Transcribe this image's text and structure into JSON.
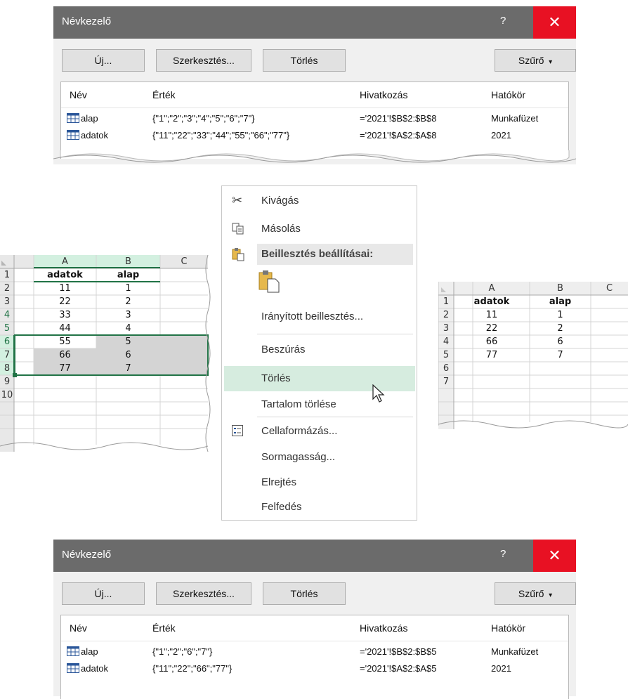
{
  "dialog_top": {
    "title": "Névkezelő",
    "help": "?",
    "close": "✕",
    "buttons": {
      "new": "Új...",
      "edit": "Szerkesztés...",
      "delete": "Törlés",
      "filter": "Szűrő"
    },
    "columns": [
      "Név",
      "Érték",
      "Hivatkozás",
      "Hatókör"
    ],
    "rows": [
      {
        "name": "alap",
        "value": "{\"1\";\"2\";\"3\";\"4\";\"5\";\"6\";\"7\"}",
        "ref": "='2021'!$B$2:$B$8",
        "scope": "Munkafüzet"
      },
      {
        "name": "adatok",
        "value": "{\"11\";\"22\";\"33\";\"44\";\"55\";\"66\";\"77\"}",
        "ref": "='2021'!$A$2:$A$8",
        "scope": "2021"
      }
    ]
  },
  "dialog_bottom": {
    "title": "Névkezelő",
    "help": "?",
    "close": "✕",
    "buttons": {
      "new": "Új...",
      "edit": "Szerkesztés...",
      "delete": "Törlés",
      "filter": "Szűrő"
    },
    "columns": [
      "Név",
      "Érték",
      "Hivatkozás",
      "Hatókör"
    ],
    "rows": [
      {
        "name": "alap",
        "value": "{\"1\";\"2\";\"6\";\"7\"}",
        "ref": "='2021'!$B$2:$B$5",
        "scope": "Munkafüzet"
      },
      {
        "name": "adatok",
        "value": "{\"11\";\"22\";\"66\";\"77\"}",
        "ref": "='2021'!$A$2:$A$5",
        "scope": "2021"
      }
    ]
  },
  "context_menu": {
    "cut": "Kivágás",
    "copy": "Másolás",
    "paste_options": "Beillesztés beállításai:",
    "paste_special": "Irányított beillesztés...",
    "insert": "Beszúrás",
    "delete": "Törlés",
    "clear_contents": "Tartalom törlése",
    "format_cells": "Cellaformázás...",
    "row_height": "Sormagasság...",
    "hide": "Elrejtés",
    "unhide": "Felfedés",
    "highlighted_item": "Törlés"
  },
  "sheet_left": {
    "col_headers": [
      "A",
      "B",
      "C"
    ],
    "row_headers": [
      "1",
      "2",
      "3",
      "4",
      "5",
      "6",
      "7",
      "8",
      "9",
      "10"
    ],
    "a": [
      "adatok",
      "11",
      "22",
      "33",
      "44",
      "55",
      "66",
      "77",
      "",
      ""
    ],
    "b": [
      "alap",
      "1",
      "2",
      "3",
      "4",
      "5",
      "6",
      "7",
      "",
      ""
    ],
    "selected_rows": [
      "4",
      "5",
      "6"
    ]
  },
  "sheet_right": {
    "col_headers": [
      "A",
      "B",
      "C"
    ],
    "row_headers": [
      "1",
      "2",
      "3",
      "4",
      "5",
      "6",
      "7"
    ],
    "a": [
      "adatok",
      "11",
      "22",
      "66",
      "77",
      "",
      ""
    ],
    "b": [
      "alap",
      "1",
      "2",
      "6",
      "7",
      "",
      ""
    ]
  },
  "colors": {
    "titlebar": "#6b6b6b",
    "close": "#e81123",
    "selection": "#d4d4d4",
    "excel_green": "#217346",
    "menu_highlight": "#d6ecdf"
  }
}
